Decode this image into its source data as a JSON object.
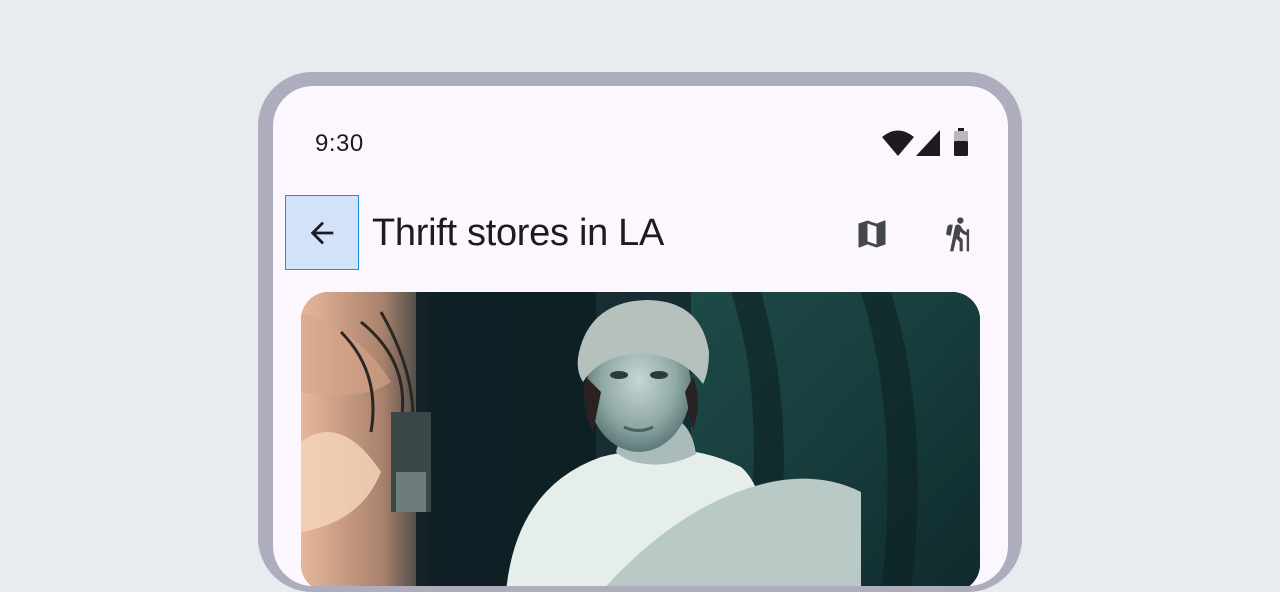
{
  "status_bar": {
    "time": "9:30",
    "icons": [
      "wifi-icon",
      "cellular-signal-icon",
      "battery-icon"
    ]
  },
  "top_app_bar": {
    "title": "Thrift stores in LA",
    "navigation_icon": "arrow-back-icon",
    "actions": [
      "map-icon",
      "hiking-icon"
    ]
  },
  "hero_image": {
    "description": ""
  },
  "colors": {
    "page_background": "#e8ecef",
    "device_frame": "#aeadbd",
    "surface": "#fcf7fe",
    "on_surface": "#1d1b20",
    "icon": "#46464f",
    "focus_highlight": "#d2e3f9",
    "focus_border": "#1f8fd9"
  }
}
